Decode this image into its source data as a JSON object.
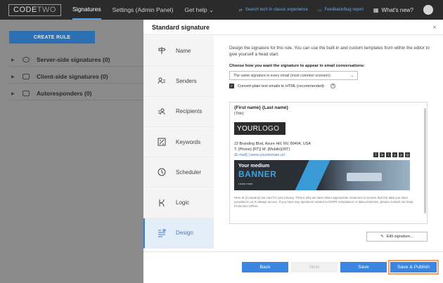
{
  "topbar": {
    "logo_main": "CODE",
    "logo_sub": "TWO",
    "nav": [
      "Signatures",
      "Settings (Admin Panel)",
      "Get help ⌄"
    ],
    "search_link": "Search tech in classic experience",
    "feedback_link": "Feedback/bug report",
    "whats_new": "What's new?"
  },
  "background": {
    "create_rule": "CREATE RULE",
    "tree": [
      "Server-side signatures (0)",
      "Client-side signatures (0)",
      "Autoresponders (0)"
    ]
  },
  "modal": {
    "title": "Standard signature",
    "close": "×",
    "steps": [
      {
        "label": "Name",
        "icon": "signpost-icon"
      },
      {
        "label": "Senders",
        "icon": "senders-icon"
      },
      {
        "label": "Recipients",
        "icon": "recipients-icon"
      },
      {
        "label": "Keywords",
        "icon": "keywords-icon"
      },
      {
        "label": "Scheduler",
        "icon": "clock-icon"
      },
      {
        "label": "Logic",
        "icon": "logic-icon"
      },
      {
        "label": "Design",
        "icon": "design-icon"
      }
    ],
    "description": "Design the signature for this rule. You can use the built-in and custom templates from within the editor to give yourself a head start.",
    "choose_label": "Choose how you want the signature to appear in email conversations:",
    "select_value": "The same signature in every email (most common scenario)",
    "convert_label": "Convert plain text emails to HTML (recommended)",
    "preview": {
      "name": "{First name} {Last name}",
      "title": "{Title}",
      "logo_a": "YOUR",
      "logo_b": "LOGO",
      "address": "22 Branding Blvd, Azure Hill, NV, 89404, USA",
      "phones": "T: {Phone} {RT}| M: {Mobile}{/RT}",
      "web": "{E-mail} | www.yourdomain.url",
      "social": [
        "f",
        "in",
        "t",
        "y",
        "p",
        "◎"
      ],
      "banner_line1": "Your medium",
      "banner_line2": "BANNER",
      "banner_line3": "Learn more",
      "privacy": "Here at {Company} we care for your privacy. That is why we have taken appropriate measures to ensure that the data you have provided to us is always secure. If you have any questions related to GDPR compliance or data protection, please contact our Data Protection Officer."
    },
    "edit_button": "Edit signature...",
    "buttons": {
      "back": "Back",
      "next": "Next",
      "save": "Save",
      "publish": "Save & Publish"
    }
  }
}
